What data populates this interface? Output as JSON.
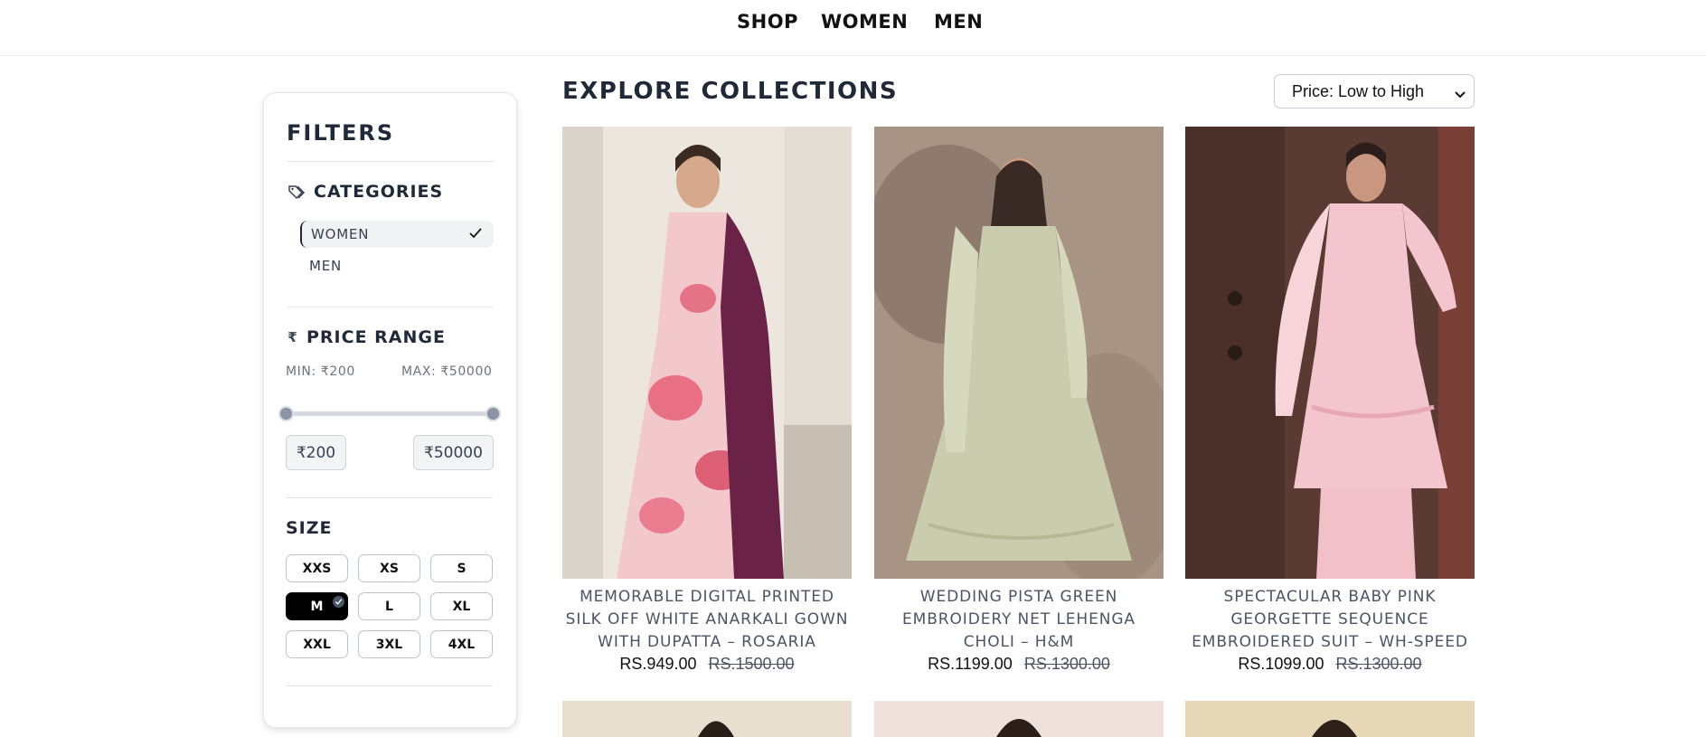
{
  "nav": {
    "shop": "SHOP",
    "women": "WOMEN",
    "men": "MEN"
  },
  "filters": {
    "title": "FILTERS",
    "categories": {
      "heading": "CATEGORIES",
      "icon": "tags-icon",
      "items": [
        {
          "label": "WOMEN",
          "selected": true
        },
        {
          "label": "MEN",
          "selected": false
        }
      ]
    },
    "price": {
      "heading": "PRICE RANGE",
      "icon": "rupee-icon",
      "min_label": "MIN: ₹200",
      "max_label": "MAX: ₹50000",
      "min_value": "₹200",
      "max_value": "₹50000",
      "range_fraction": [
        0,
        1
      ]
    },
    "size": {
      "heading": "SIZE",
      "options": [
        "XXS",
        "XS",
        "S",
        "M",
        "L",
        "XL",
        "XXL",
        "3XL",
        "4XL"
      ],
      "selected": "M"
    }
  },
  "main": {
    "title": "EXPLORE COLLECTIONS",
    "sort": {
      "selected": "Price: Low to High"
    }
  },
  "products": [
    {
      "name": "MEMORABLE DIGITAL PRINTED SILK OFF WHITE ANARKALI GOWN WITH DUPATTA – ROSARIA",
      "price": "RS.949.00",
      "old_price": "RS.1500.00"
    },
    {
      "name": "WEDDING PISTA GREEN EMBROIDERY NET LEHENGA CHOLI – H&M",
      "price": "RS.1199.00",
      "old_price": "RS.1300.00"
    },
    {
      "name": "SPECTACULAR BABY PINK GEORGETTE SEQUENCE EMBROIDERED SUIT – WH-SPEED",
      "price": "RS.1099.00",
      "old_price": "RS.1300.00"
    }
  ],
  "colors": {
    "accent": "#000000",
    "text": "#1f2937",
    "muted": "#4b5563",
    "border": "#e4e6ea"
  }
}
